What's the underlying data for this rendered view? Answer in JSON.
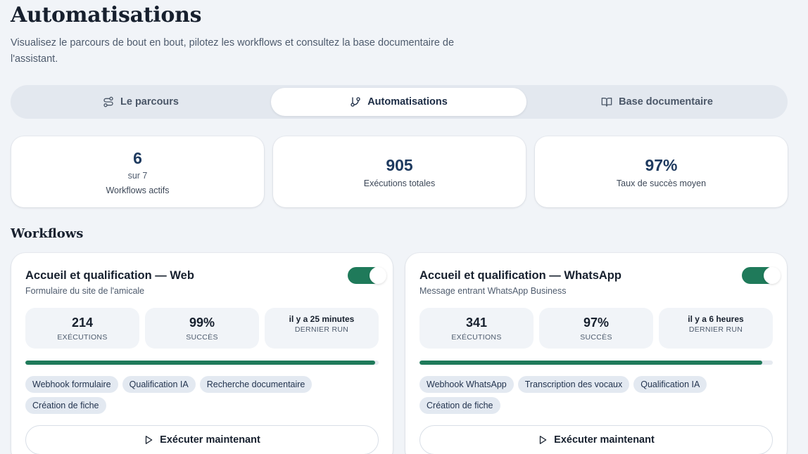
{
  "header": {
    "title": "Automatisations",
    "subtitle": "Visualisez le parcours de bout en bout, pilotez les workflows et consultez la base documentaire de l'assistant."
  },
  "tabs": [
    {
      "label": "Le parcours",
      "icon": "route-icon",
      "active": false
    },
    {
      "label": "Automatisations",
      "icon": "git-branch-icon",
      "active": true
    },
    {
      "label": "Base documentaire",
      "icon": "book-open-icon",
      "active": false
    }
  ],
  "stats": {
    "active": {
      "value": "6",
      "sub": "sur 7",
      "label": "Workflows actifs"
    },
    "executions": {
      "value": "905",
      "label": "Exécutions totales"
    },
    "success": {
      "value": "97%",
      "label": "Taux de succès moyen"
    }
  },
  "section": {
    "title": "Workflows"
  },
  "workflows": [
    {
      "title": "Accueil et qualification — Web",
      "trigger": "Formulaire du site de l'amicale",
      "enabled": true,
      "executions": "214",
      "executions_label": "EXÉCUTIONS",
      "success": "99%",
      "success_label": "SUCCÈS",
      "last_run": "il y a 25 minutes",
      "last_run_label": "DERNIER RUN",
      "success_rate": 0.99,
      "steps": [
        "Webhook formulaire",
        "Qualification IA",
        "Recherche documentaire",
        "Création de fiche"
      ],
      "run_label": "Exécuter maintenant"
    },
    {
      "title": "Accueil et qualification — WhatsApp",
      "trigger": "Message entrant WhatsApp Business",
      "enabled": true,
      "executions": "341",
      "executions_label": "EXÉCUTIONS",
      "success": "97%",
      "success_label": "SUCCÈS",
      "last_run": "il y a 6 heures",
      "last_run_label": "DERNIER RUN",
      "success_rate": 0.97,
      "steps": [
        "Webhook WhatsApp",
        "Transcription des vocaux",
        "Qualification IA",
        "Création de fiche"
      ],
      "run_label": "Exécuter maintenant"
    }
  ],
  "colors": {
    "accent_green": "#1f7a5a",
    "navy": "#1e3a5f"
  }
}
